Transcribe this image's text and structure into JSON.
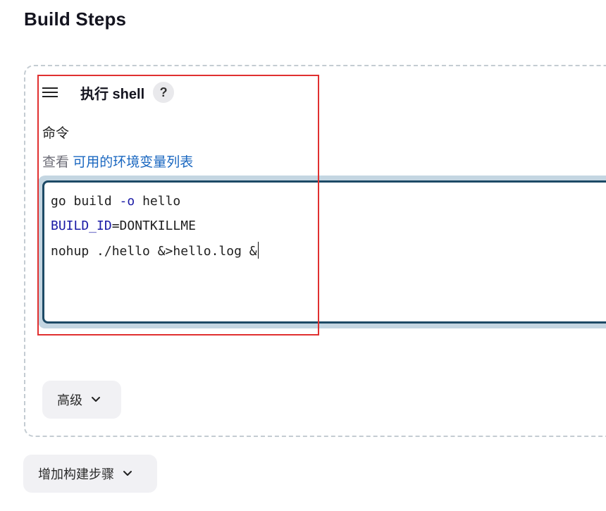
{
  "section": {
    "title": "Build Steps"
  },
  "step": {
    "title": "执行 shell",
    "help_label": "?",
    "command_label": "命令",
    "env_prefix": "查看",
    "env_link": "可用的环境变量列表",
    "code": {
      "line1": {
        "a": "go build ",
        "flag": "-o",
        "b": " hello"
      },
      "line2": {
        "var": "BUILD_ID",
        "rest": "=DONTKILLME"
      },
      "line3": "nohup ./hello &>hello.log &"
    }
  },
  "buttons": {
    "advanced": "高级",
    "add_step": "增加构建步骤"
  },
  "icons": {
    "drag": "hamburger-menu-icon",
    "help": "question-mark-icon",
    "chevron": "chevron-down-icon"
  },
  "colors": {
    "highlight": "#e03030",
    "link": "#1a67c0",
    "keyword": "#1a1aa6",
    "editor_border": "#1d4a66"
  }
}
